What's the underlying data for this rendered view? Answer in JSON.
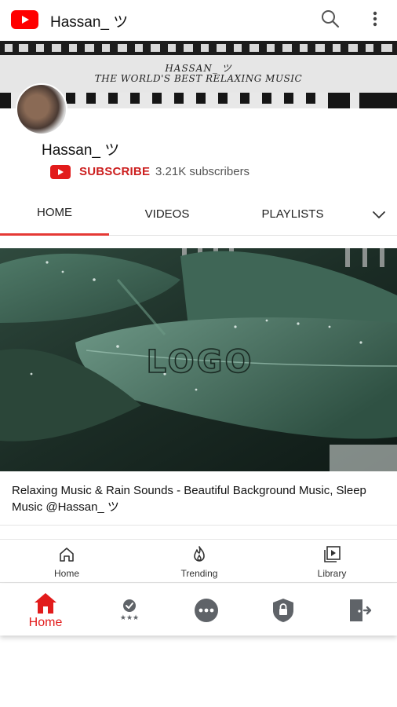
{
  "app_bar": {
    "title": "Hassan_ ツ",
    "icons": [
      "youtube-logo-icon",
      "search-icon",
      "more-vert-icon"
    ]
  },
  "banner": {
    "name_text": "HASSAN_ ツ",
    "tagline_text": "THE WORLD'S BEST RELAXING MUSIC"
  },
  "channel": {
    "name": "Hassan_ ツ",
    "subscribe_label": "SUBSCRIBE",
    "subscriber_count": "3.21K subscribers"
  },
  "tabs": [
    {
      "label": "HOME",
      "active": true
    },
    {
      "label": "VIDEOS",
      "active": false
    },
    {
      "label": "PLAYLISTS",
      "active": false
    }
  ],
  "video": {
    "title": "Relaxing Music & Rain Sounds - Beautiful Background Music, Sleep Music @Hassan_ ツ"
  },
  "youtube_nav": [
    {
      "label": "Home",
      "icon": "home-outline-icon"
    },
    {
      "label": "Trending",
      "icon": "flame-icon"
    },
    {
      "label": "Library",
      "icon": "library-icon"
    }
  ],
  "app_nav": {
    "home_label": "Home",
    "icons": [
      "home-icon",
      "rating-icon",
      "more-horiz-icon",
      "lock-shield-icon",
      "exit-icon"
    ]
  },
  "colors": {
    "accent_red": "#e21b1b",
    "subscribe_red": "#cc1f1f",
    "tab_indicator": "#e53935"
  }
}
